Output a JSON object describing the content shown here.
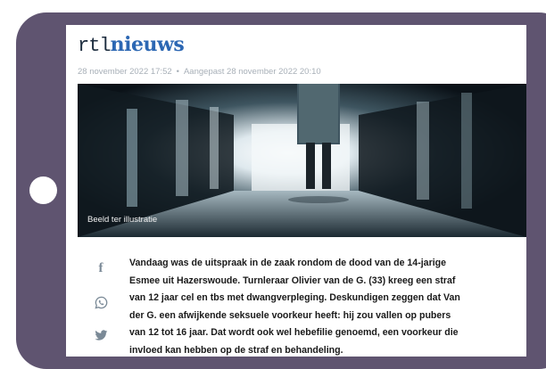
{
  "logo": {
    "prefix": "rtl",
    "brand": "nieuws"
  },
  "meta": {
    "published": "28 november 2022 17:52",
    "separator": "•",
    "updated": "Aangepast 28 november 2022 20:10"
  },
  "photo": {
    "caption": "Beeld ter illustratie"
  },
  "share": {
    "facebook_glyph": "f",
    "items": [
      {
        "icon": "facebook-icon"
      },
      {
        "icon": "whatsapp-icon"
      },
      {
        "icon": "twitter-icon"
      }
    ]
  },
  "article": {
    "lines": [
      "Vandaag was de uitspraak in de zaak rondom de dood van de 14-jarige",
      "Esmee uit Hazerswoude. Turnleraar Olivier van de G. (33) kreeg een straf",
      "van 12 jaar cel en tbs met dwangverpleging. Deskundigen zeggen dat Van",
      "der G. een afwijkende seksuele voorkeur heeft: hij zou vallen op pubers",
      "van 12 tot 16 jaar. Dat wordt ook wel hebefilie genoemd, een voorkeur die",
      "invloed kan hebben op de straf en behandeling."
    ]
  },
  "colors": {
    "frame": "#5f5470",
    "brand_blue": "#2c67b3",
    "logo_dark": "#1d2d3f",
    "meta_grey": "#a8b0b8",
    "icon_grey": "#7b8a97"
  }
}
